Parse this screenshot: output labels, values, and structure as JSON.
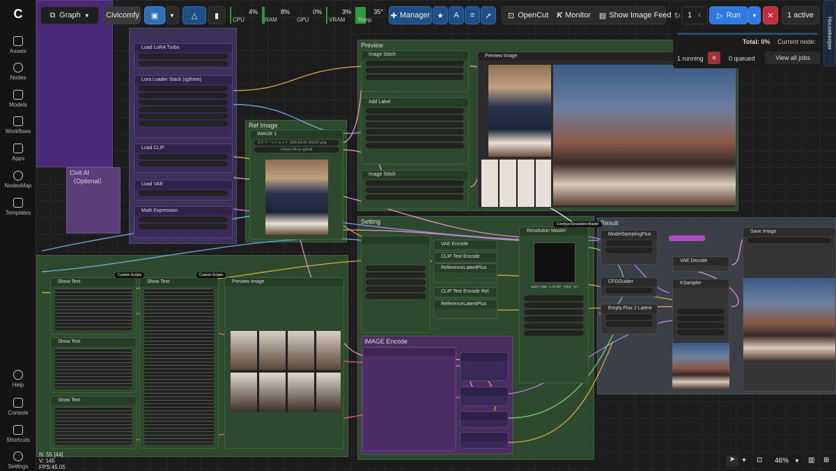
{
  "topbar": {
    "graph_label": "Graph",
    "workflow_tab": "Civicomfy",
    "cpu": {
      "label": "CPU",
      "value": "4%",
      "level": 0.04
    },
    "ram": {
      "label": "RAM",
      "value": "8%",
      "level": 0.08
    },
    "gpu": {
      "label": "GPU",
      "value": "0%",
      "level": 0.0
    },
    "vram": {
      "label": "VRAM",
      "value": "3%",
      "level": 0.03
    },
    "temp": {
      "label": "Temp",
      "value": "35°",
      "level": 0.35
    },
    "manager_label": "Manager",
    "opencut_label": "OpenCut",
    "monitor_label": "Monitor",
    "show_feed_label": "Show Image Feed",
    "batch_count": "1",
    "run_label": "Run",
    "active_label": "1 active",
    "housekeeper_label": "Housekeeper"
  },
  "queue": {
    "total": "Total: 0%",
    "current_node": "Current node:",
    "running": "1 running",
    "queued": "0 queued",
    "view_all": "View all jobs"
  },
  "sidebar": {
    "items": [
      {
        "label": "Assets",
        "icon": "image-icon"
      },
      {
        "label": "Nodes",
        "icon": "nodes-icon"
      },
      {
        "label": "Models",
        "icon": "cube-icon"
      },
      {
        "label": "Workflows",
        "icon": "workflow-icon"
      },
      {
        "label": "Apps",
        "icon": "apps-icon"
      },
      {
        "label": "NodesMap",
        "icon": "map-icon"
      },
      {
        "label": "Templates",
        "icon": "templates-icon"
      },
      {
        "label": "Help",
        "icon": "help-icon"
      },
      {
        "label": "Console",
        "icon": "console-icon"
      },
      {
        "label": "Shortcuts",
        "icon": "keyboard-icon"
      },
      {
        "label": "Settings",
        "icon": "gear-icon"
      }
    ]
  },
  "canvas": {
    "groups": {
      "preview": "Preview",
      "ref_image": "Ref Image",
      "civitai": "Civit AI（Optional）",
      "setting": "Setting",
      "result": "Result",
      "image_encode": "IMAGE Encode"
    },
    "nodes": {
      "load_lora_turbo": "Load LoRA Turbo",
      "lora_loader_stack": "Lora Loader Stack (rgthree)",
      "load_clip": "Load CLIP",
      "load_vae": "Load VAE",
      "math_expression": "Math Expression",
      "image_node": "IMAGE 1",
      "image_file": "スクリーンショット 2026-03-26 162337.png",
      "choose_file": "choose file to upload",
      "image_stitch_1": "Image Stitch",
      "add_label": "Add Label",
      "image_stitch_2": "Image Stitch",
      "preview_image": "Preview Image",
      "resolution_master": "Resolution Master",
      "resolution_badge": "Comfyui-Resolution-Master",
      "vae_encode": "VAE Encode",
      "clip_text_encode_1": "CLIP Text Encode",
      "reference_latent_1": "ReferenceLatentPlus",
      "clip_text_encode_2": "CLIP Text Encode Rel",
      "reference_latent_2": "ReferenceLatentPlus",
      "model_sampling": "ModelSamplingFlux",
      "cfg_guider": "CFGGuider",
      "empty_flux_latent": "Empty Flux 2 Latent",
      "vae_decode": "VAE Decode",
      "ksampler": "KSampler",
      "save_image": "Save Image",
      "show_text_1": "Show Text",
      "show_text_2": "Show Text",
      "show_text_3": "Show Text",
      "show_text_4": "Show Text",
      "preview_image_2": "Preview Image",
      "custom_scripts": "Custom-Scripts",
      "res_readout": "1152 × 896 · 1.03 MP · Fit(s) · 9:7"
    }
  },
  "status": {
    "n": "N: 55 [44]",
    "v": "V: 145",
    "fps": "FPS:45.05",
    "zoom": "46%"
  }
}
